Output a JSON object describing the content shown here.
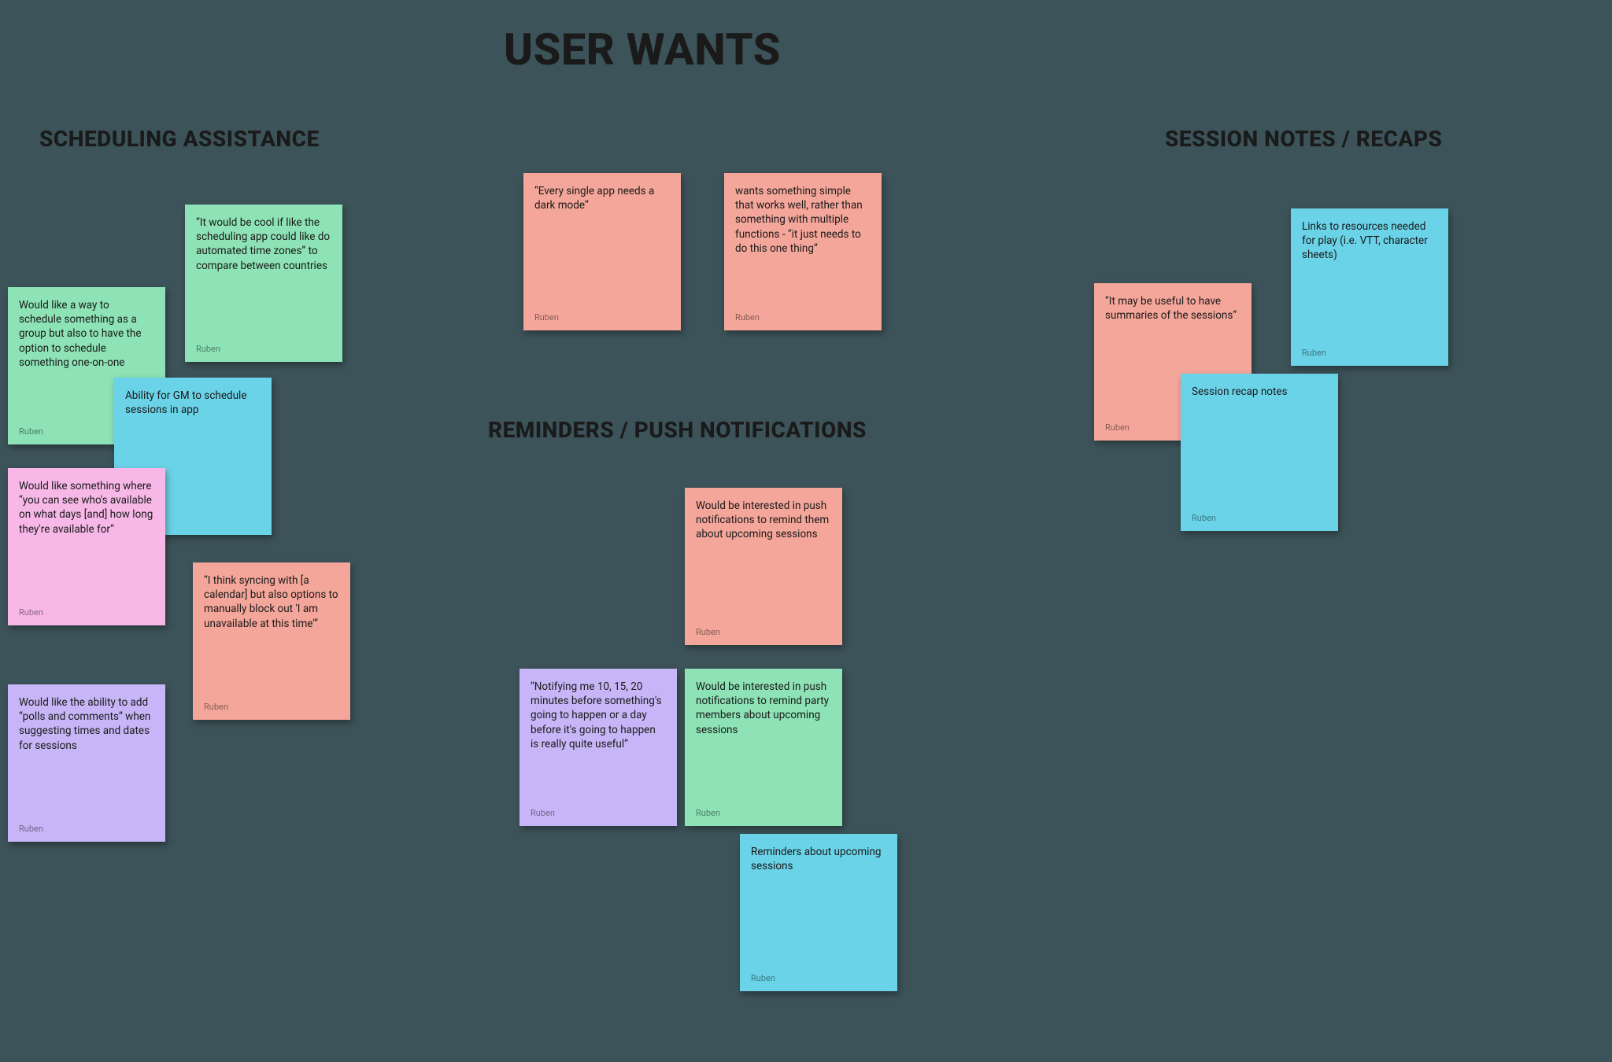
{
  "titles": {
    "main": "USER WANTS",
    "scheduling": "SCHEDULING ASSISTANCE",
    "reminders": "REMINDERS / PUSH NOTIFICATIONS",
    "notes": "SESSION NOTES / RECAPS"
  },
  "author": "Ruben",
  "stickies": {
    "sched_group_oneonone": "Would like a way to schedule something as a group but also to have the option to schedule something one-on-one",
    "sched_timezones": "“It would be cool if like the scheduling app could like do automated time zones” to compare between countries",
    "sched_gm_sessions": "Ability for GM to schedule sessions in app",
    "sched_availability": "Would like something where “you can see who's available on what days [and] how long they're available for”",
    "sched_calendar_sync": "“I think syncing with [a calendar] but also options to manually block out 'I am unavailable at this time'”",
    "sched_polls": "Would like the ability to add “polls and comments” when suggesting times and dates for sessions",
    "general_darkmode": "“Every single app needs a dark mode”",
    "general_simple": "wants something simple that works well, rather than something with multiple functions - “it just needs to do this one thing”",
    "rem_push_self": "Would be interested in push notifications to remind them about upcoming sessions",
    "rem_timing": "“Notifying me 10, 15, 20 minutes before something's going to happen or a day before it's going to happen is really quite useful”",
    "rem_push_party": "Would be interested in push notifications to remind party members about upcoming sessions",
    "rem_upcoming": "Reminders about upcoming sessions",
    "notes_summaries": "“It may be useful to have summaries of the sessions”",
    "notes_resources": "Links to resources needed for play (i.e. VTT, character sheets)",
    "notes_recap": "Session recap notes"
  }
}
